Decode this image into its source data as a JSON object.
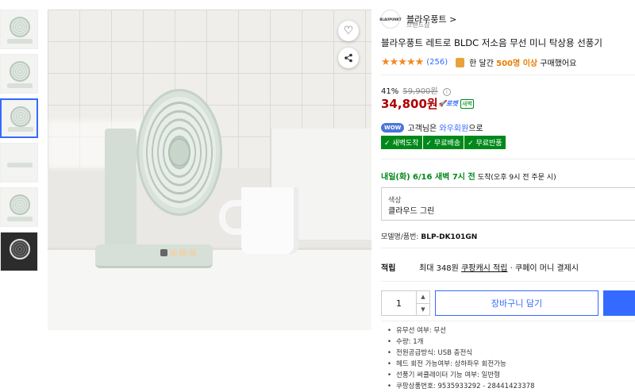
{
  "gallery": {
    "thumbnails": [
      "thumb-1",
      "thumb-2",
      "thumb-3",
      "thumb-4",
      "thumb-5",
      "thumb-6"
    ],
    "active_index": 2
  },
  "product": {
    "brand": "블라우풍트 >",
    "brand_logo": "BLAUPUNKT",
    "brand_sub": "브랜드샵",
    "title": "블라우풍트 레트로 BLDC 저소음 무선 미니 탁상용 선풍기",
    "stars": "★★★★★",
    "star_color": "#f08a24",
    "review_count": "(256)",
    "buy_prefix": "한 달간",
    "buy_count": "500명 이상",
    "buy_suffix": "구매했어요"
  },
  "price": {
    "discount": "41%",
    "original": "59,900원",
    "info": "i",
    "sale": "34,800원",
    "rocket": "🚀로켓",
    "saebyeok": "새벽",
    "accent_color": "#ae0000"
  },
  "wow": {
    "badge": "WOW",
    "text_prefix": "고객님은",
    "link": "와우회원",
    "text_suffix": "으로"
  },
  "benefit_tags": [
    "✓ 새벽도착",
    "✓ 무료배송",
    "✓ 무료반품"
  ],
  "delivery": {
    "day": "내일(화)",
    "date": "6/16 새벽 7시 전",
    "verb": "도착",
    "detail": "(오후 9시 전 주문 시)"
  },
  "option": {
    "label": "색상",
    "value": "클라우드 그린"
  },
  "model": {
    "label": "모델명/품번:",
    "value": "BLP-DK101GN"
  },
  "points": {
    "label": "적립",
    "prefix": "최대 348원",
    "link": "쿠팡캐시 적립",
    "suffix": "· 쿠페이 머니 결제시"
  },
  "cart": {
    "quantity": "1",
    "up": "▲",
    "down": "▼",
    "add_to_cart": "장바구니 담기"
  },
  "specs": [
    "유무선 여부: 무선",
    "수량: 1개",
    "전원공급방식: USB 충전식",
    "헤드 회전 가능여부: 상하좌우 회전가능",
    "선풍기 써큘레이터 기능 여부: 일반형",
    "쿠팡상품번호: 9535933292 - 28441423378"
  ]
}
